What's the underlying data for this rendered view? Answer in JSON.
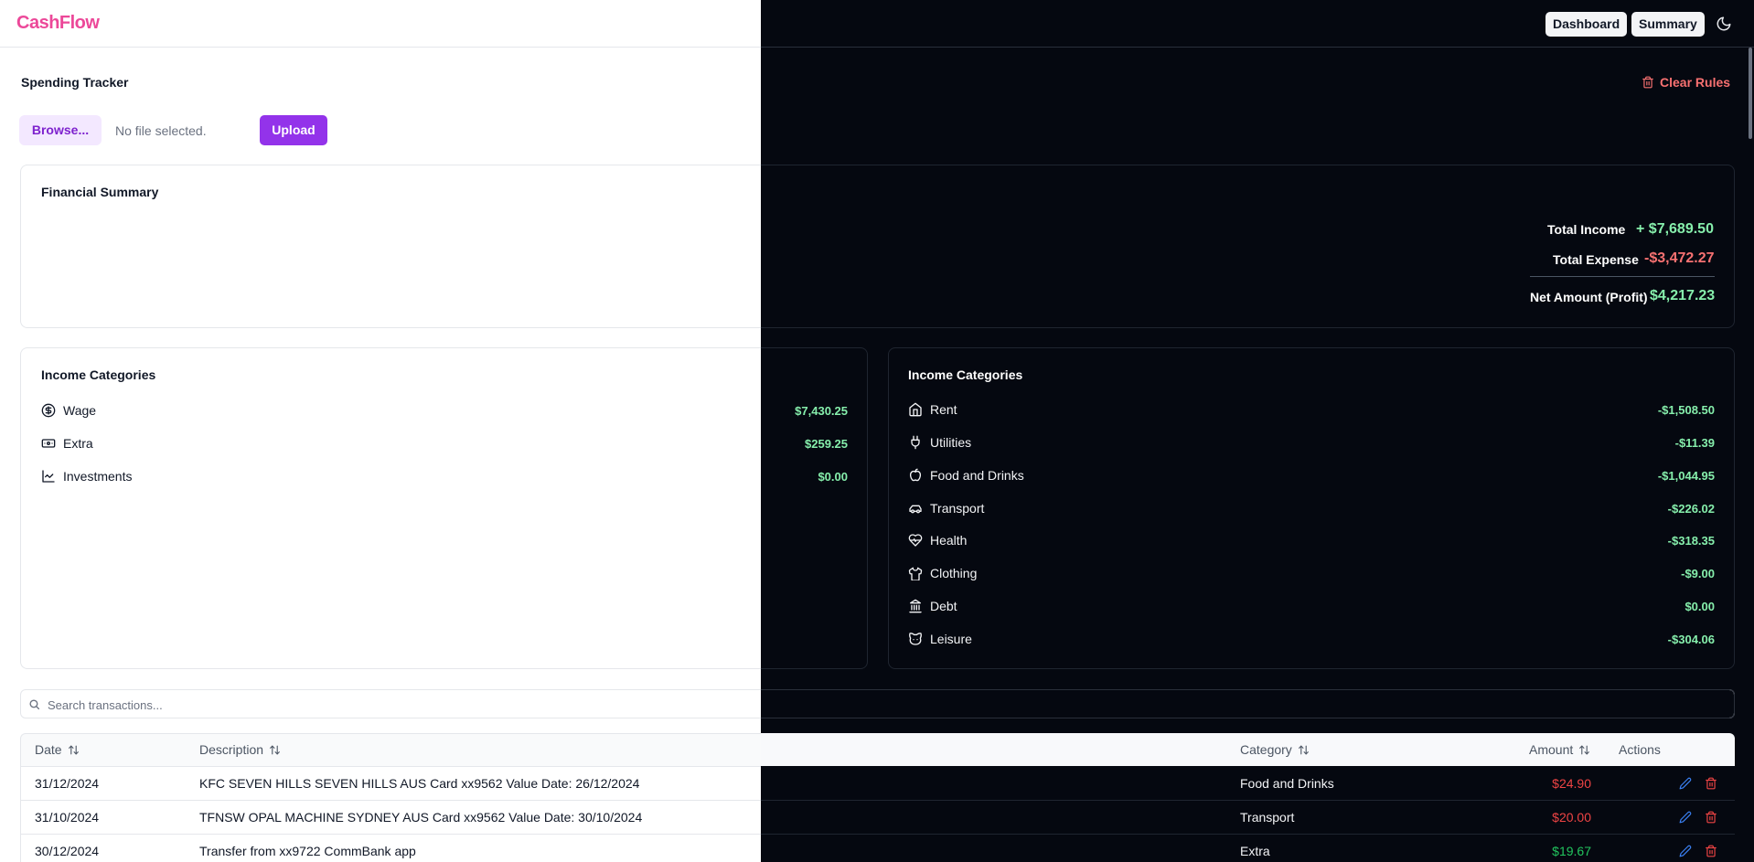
{
  "header": {
    "logo": "CashFlow",
    "nav": {
      "dashboard": "Dashboard",
      "summary": "Summary"
    },
    "theme_icon": "moon-icon"
  },
  "tracker": {
    "title": "Spending Tracker",
    "browse_label": "Browse...",
    "file_status": "No file selected.",
    "upload_label": "Upload",
    "clear_rules_label": "Clear Rules"
  },
  "summary": {
    "title": "Financial Summary",
    "total_income_label": "Total Income",
    "total_income_value": "+ $7,689.50",
    "total_expense_label": "Total Expense",
    "total_expense_value": "-$3,472.27",
    "net_label": "Net Amount (Profit)",
    "net_value": "$4,217.23"
  },
  "income_categories": {
    "title": "Income Categories",
    "items": [
      {
        "label": "Wage",
        "amount": "$7,430.25",
        "icon": "dollar-circle-icon"
      },
      {
        "label": "Extra",
        "amount": "$259.25",
        "icon": "banknote-icon"
      },
      {
        "label": "Investments",
        "amount": "$0.00",
        "icon": "line-chart-icon"
      }
    ]
  },
  "expense_categories": {
    "title": "Income Categories",
    "items": [
      {
        "label": "Rent",
        "amount": "-$1,508.50",
        "icon": "home-icon"
      },
      {
        "label": "Utilities",
        "amount": "-$11.39",
        "icon": "plug-icon"
      },
      {
        "label": "Food and Drinks",
        "amount": "-$1,044.95",
        "icon": "apple-icon"
      },
      {
        "label": "Transport",
        "amount": "-$226.02",
        "icon": "car-icon"
      },
      {
        "label": "Health",
        "amount": "-$318.35",
        "icon": "heart-pulse-icon"
      },
      {
        "label": "Clothing",
        "amount": "-$9.00",
        "icon": "shirt-icon"
      },
      {
        "label": "Debt",
        "amount": "$0.00",
        "icon": "bank-icon"
      },
      {
        "label": "Leisure",
        "amount": "-$304.06",
        "icon": "cat-icon"
      }
    ]
  },
  "search": {
    "placeholder": "Search transactions..."
  },
  "table": {
    "columns": {
      "date": "Date",
      "description": "Description",
      "category": "Category",
      "amount": "Amount",
      "actions": "Actions"
    },
    "rows": [
      {
        "date": "31/12/2024",
        "description": "KFC SEVEN HILLS SEVEN HILLS AUS Card xx9562 Value Date: 26/12/2024",
        "category": "Food and Drinks",
        "amount": "$24.90",
        "type": "expense"
      },
      {
        "date": "31/10/2024",
        "description": "TFNSW OPAL MACHINE SYDNEY AUS Card xx9562 Value Date: 30/10/2024",
        "category": "Transport",
        "amount": "$20.00",
        "type": "expense"
      },
      {
        "date": "30/12/2024",
        "description": "Transfer from xx9722 CommBank app",
        "category": "Extra",
        "amount": "$19.67",
        "type": "income"
      }
    ]
  },
  "colors": {
    "brand": "#ec4899",
    "accent": "#9333ea",
    "income_green": "#86efac",
    "expense_red": "#f87171",
    "dark_bg": "#050810"
  }
}
